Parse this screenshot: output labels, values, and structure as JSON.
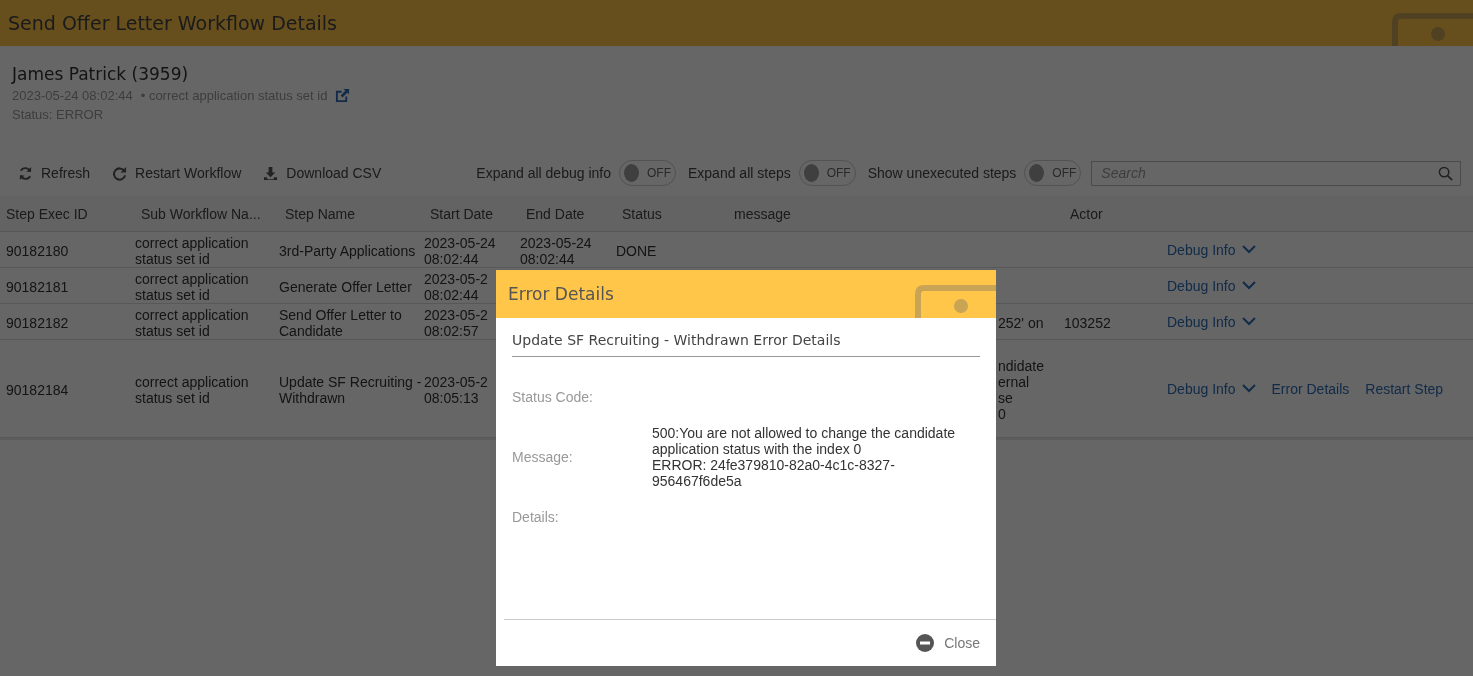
{
  "header": {
    "title": "Send Offer Letter Workflow Details"
  },
  "candidate": {
    "name": "James Patrick (3959)",
    "timestamp": "2023-05-24 08:02:44",
    "workflow": "• correct application status set id",
    "status": "Status: ERROR"
  },
  "toolbar": {
    "actions": [
      {
        "kind": "refresh",
        "label": "Refresh"
      },
      {
        "kind": "restart",
        "label": "Restart Workflow"
      },
      {
        "kind": "download",
        "label": "Download CSV"
      }
    ],
    "toggles": [
      {
        "label": "Expand all debug info",
        "on": false,
        "state": "OFF"
      },
      {
        "label": "Expand all steps",
        "on": false,
        "state": "OFF"
      },
      {
        "label": "Show unexecuted steps",
        "on": false,
        "state": "OFF"
      }
    ],
    "search": {
      "placeholder": "Search"
    }
  },
  "table": {
    "columns": [
      "Step Exec ID",
      "Sub Workflow Na...",
      "Step Name",
      "Start Date",
      "End Date",
      "Status",
      "message",
      "Actor"
    ],
    "rows": [
      {
        "id": "90182180",
        "sub_workflow": "correct application status set id",
        "step_name": "3rd-Party Applications",
        "start_date": "2023-05-24",
        "start_time": "08:02:44",
        "end_date": "2023-05-24",
        "end_time": "08:02:44",
        "status": "DONE",
        "actions": [
          {
            "kind": "debug",
            "label": "Debug Info"
          }
        ]
      },
      {
        "id": "90182181",
        "sub_workflow": "correct application status set id",
        "step_name": "Generate Offer Letter",
        "start_date": "2023-05-2",
        "start_time": "08:02:44",
        "actions": [
          {
            "kind": "debug",
            "label": "Debug Info"
          }
        ]
      },
      {
        "id": "90182182",
        "sub_workflow": "correct application status set id",
        "step_name": "Send Offer Letter to Candidate",
        "start_date": "2023-05-2",
        "start_time": "08:02:57",
        "message": [
          "252' on"
        ],
        "actor": "103252",
        "actions": [
          {
            "kind": "debug",
            "label": "Debug Info"
          }
        ]
      },
      {
        "id": "90182184",
        "sub_workflow": "correct application status set id",
        "step_name": "Update SF Recruiting - Withdrawn",
        "start_date": "2023-05-2",
        "start_time": "08:05:13",
        "message": [
          "ndidate",
          "ernal",
          "se",
          "0"
        ],
        "actions": [
          {
            "kind": "debug",
            "label": "Debug Info"
          },
          {
            "kind": "link",
            "label": "Error Details"
          },
          {
            "kind": "link",
            "label": "Restart Step"
          }
        ]
      }
    ]
  },
  "modal": {
    "title": "Error Details",
    "subtitle": "Update SF Recruiting - Withdrawn Error Details",
    "fields": [
      {
        "label": "Status Code:"
      },
      {
        "label": "Message:",
        "value": [
          "500:You are not allowed to change the candidate application status with the index 0",
          "ERROR: 24fe379810-82a0-4c1c-8327-956467f6de5a"
        ]
      },
      {
        "label": "Details:"
      }
    ],
    "close": "Close"
  }
}
